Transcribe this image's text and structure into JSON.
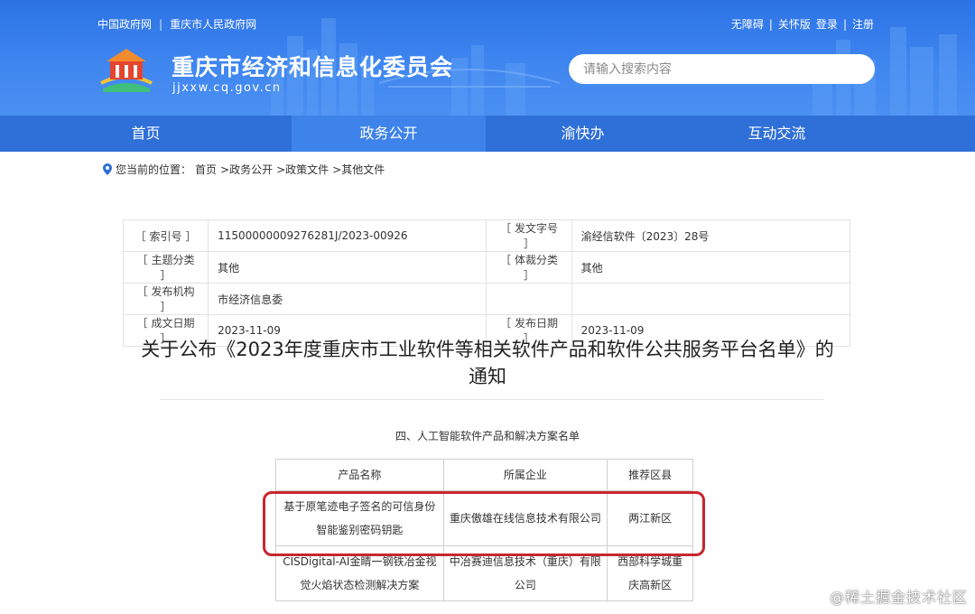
{
  "header": {
    "top_links": [
      "中国政府网",
      "重庆市人民政府网"
    ],
    "top_sep": "|",
    "top_right": {
      "accessibility": "无障碍",
      "care_mode": "关怀版",
      "login": "登录",
      "register": "注册"
    },
    "site_title": "重庆市经济和信息化委员会",
    "site_domain": "jjxxw.cq.gov.cn",
    "search_placeholder": "请输入搜索内容"
  },
  "nav": {
    "items": [
      {
        "label": "首页",
        "active": false
      },
      {
        "label": "政务公开",
        "active": true
      },
      {
        "label": "渝快办",
        "active": false
      },
      {
        "label": "互动交流",
        "active": false
      }
    ]
  },
  "breadcrumb": {
    "prefix": "您当前的位置：",
    "items": [
      "首页",
      ">政务公开",
      ">政策文件",
      ">其他文件"
    ]
  },
  "meta": {
    "rows": [
      {
        "k1": "［ 索引号 ］",
        "v1": "11500000009276281J/2023-00926",
        "k2": "［ 发文字号 ］",
        "v2": "渝经信软件〔2023〕28号"
      },
      {
        "k1": "［ 主题分类 ］",
        "v1": "其他",
        "k2": "［ 体裁分类 ］",
        "v2": "其他"
      },
      {
        "k1": "［ 发布机构 ］",
        "v1": "市经济信息委",
        "k2": "",
        "v2": ""
      },
      {
        "k1": "［ 成文日期 ］",
        "v1": "2023-11-09",
        "k2": "［ 发布日期 ］",
        "v2": "2023-11-09"
      }
    ]
  },
  "article": {
    "title_line1": "关于公布《2023年度重庆市工业软件等相关软件产品和软件公共服务平台名单》的",
    "title_line2": "通知",
    "section_heading": "四、人工智能软件产品和解决方案名单"
  },
  "products": {
    "headers": [
      "产品名称",
      "所属企业",
      "推荐区县"
    ],
    "rows": [
      {
        "name_l1": "基于原笔迹电子签名的可信身份",
        "name_l2": "智能鉴别密码钥匙",
        "company_l1": "重庆傲雄在线信息技术有限公司",
        "company_l2": "",
        "district_l1": "两江新区",
        "district_l2": ""
      },
      {
        "name_l1": "CISDigital-AI金睛一钢铁冶金视",
        "name_l2": "觉火焰状态检测解决方案",
        "company_l1": "中冶赛迪信息技术（重庆）有限",
        "company_l2": "公司",
        "district_l1": "西部科学城重",
        "district_l2": "庆高新区"
      }
    ]
  },
  "watermark": "@稀土掘金技术社区",
  "colors": {
    "banner": "#3f86f0",
    "nav": "#2f6fd8",
    "nav_active": "#3e83ea",
    "highlight": "#c8262e"
  }
}
